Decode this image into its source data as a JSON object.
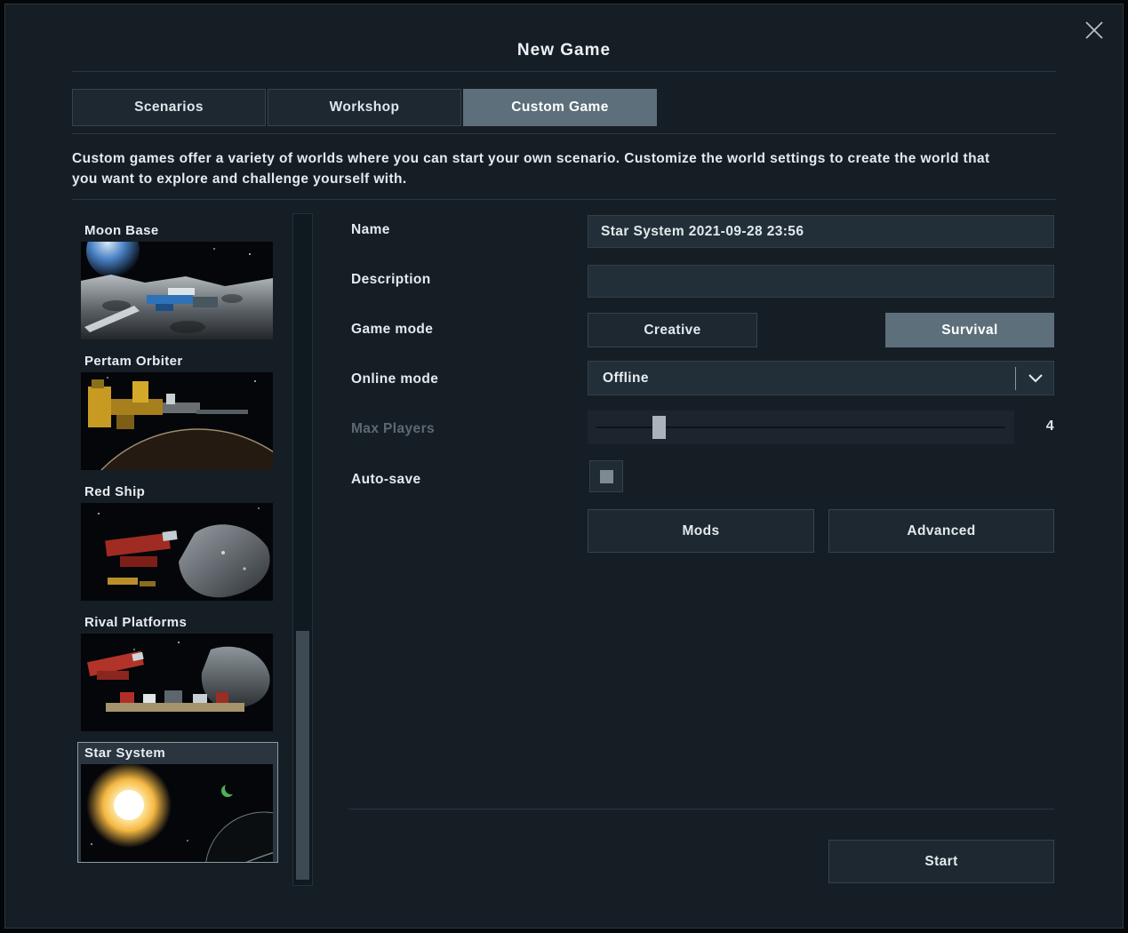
{
  "dialog": {
    "title": "New Game"
  },
  "tabs": [
    {
      "label": "Scenarios",
      "active": false
    },
    {
      "label": "Workshop",
      "active": false
    },
    {
      "label": "Custom Game",
      "active": true
    }
  ],
  "intro_text": "Custom games offer a variety of worlds where you can start your own scenario. Customize the world settings to create the world that you want to explore and challenge yourself with.",
  "scenario_list": [
    {
      "name": "Moon Base",
      "selected": false
    },
    {
      "name": "Pertam Orbiter",
      "selected": false
    },
    {
      "name": "Red Ship",
      "selected": false
    },
    {
      "name": "Rival Platforms",
      "selected": false
    },
    {
      "name": "Star System",
      "selected": true
    }
  ],
  "form": {
    "name_label": "Name",
    "name_value": "Star System 2021-09-28 23:56",
    "description_label": "Description",
    "description_value": "",
    "game_mode_label": "Game mode",
    "game_mode_options": [
      "Creative",
      "Survival"
    ],
    "game_mode_selected": "Survival",
    "online_mode_label": "Online mode",
    "online_mode_value": "Offline",
    "max_players_label": "Max Players",
    "max_players_value": "4",
    "autosave_label": "Auto-save",
    "autosave_checked": true,
    "mods_button": "Mods",
    "advanced_button": "Advanced",
    "start_button": "Start"
  },
  "colors": {
    "accent_active": "#5d6f7a",
    "dialog_bg": "#161e25",
    "panel_border": "#36434d"
  }
}
